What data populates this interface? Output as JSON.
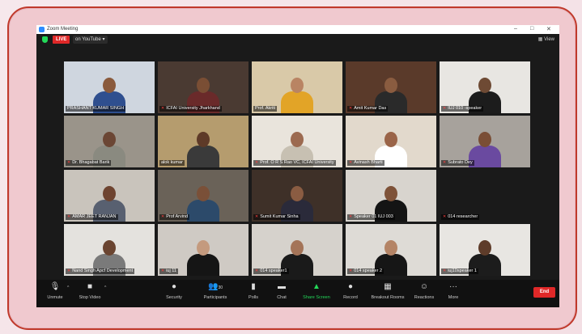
{
  "window": {
    "title": "Zoom Meeting",
    "minimize": "–",
    "maximize": "□",
    "close": "✕"
  },
  "topbar": {
    "live_label": "LIVE",
    "stream_label": "on YouTube ▾",
    "view_label": "▦ View"
  },
  "participants": [
    {
      "name": "PRASHANT KUMAR SINGH",
      "muted": false,
      "bg": "#cfd6df",
      "skin": "#8a5a3c",
      "shirt": "#2f4f8f",
      "active": false
    },
    {
      "name": "ICFAI University Jharkhand",
      "muted": true,
      "bg": "#4a3a32",
      "skin": "#7a4e34",
      "shirt": "#6a2a2a",
      "active": false
    },
    {
      "name": "Prof. Akriti",
      "muted": false,
      "bg": "#d9c9a8",
      "skin": "#b98463",
      "shirt": "#e2a427",
      "active": true
    },
    {
      "name": "Amit Kumar Das",
      "muted": true,
      "bg": "#5a3a2a",
      "skin": "#8a5c40",
      "shirt": "#2a2a2a",
      "active": false
    },
    {
      "name": "IUJ 010 -speaker",
      "muted": true,
      "bg": "#e8e6e2",
      "skin": "#6e4a34",
      "shirt": "#1c1c1c",
      "active": false
    },
    {
      "name": "Dr. Bhagabat Barik",
      "muted": true,
      "bg": "#9a948a",
      "skin": "#6b4634",
      "shirt": "#8a8a80",
      "active": false
    },
    {
      "name": "alok kumar",
      "muted": false,
      "bg": "#b59c6e",
      "skin": "#5e3a28",
      "shirt": "#3a3a3a",
      "active": false
    },
    {
      "name": "Prof. O R S Rao VC, ICFAI University",
      "muted": true,
      "bg": "#e9e4dc",
      "skin": "#9c6a50",
      "shirt": "#c7c0b2",
      "active": false
    },
    {
      "name": "Avinash Bharti",
      "muted": true,
      "bg": "#e2d9cc",
      "skin": "#9a6448",
      "shirt": "#ffffff",
      "active": false
    },
    {
      "name": "Subrato Dey",
      "muted": true,
      "bg": "#a7a29c",
      "skin": "#7a4e36",
      "shirt": "#6a4aa0",
      "active": false
    },
    {
      "name": "AMAR JEET RANJAN",
      "muted": true,
      "bg": "#c9c4bc",
      "skin": "#6e4430",
      "shirt": "#586070",
      "active": false
    },
    {
      "name": "Prof Arvind",
      "muted": true,
      "bg": "#6a6258",
      "skin": "#7a5038",
      "shirt": "#2c4a6a",
      "active": false
    },
    {
      "name": "Sumit Kumar Sinha",
      "muted": true,
      "bg": "#3e3028",
      "skin": "#8a5c42",
      "shirt": "#2a2a3a",
      "active": false
    },
    {
      "name": "Speaker 01 IUJ 003",
      "muted": true,
      "bg": "#d8d4ce",
      "skin": "#7e5238",
      "shirt": "#141414",
      "active": false
    },
    {
      "name": "014 researcher",
      "muted": true,
      "bg": "#1a1a1a",
      "skin": "#3a3a3a",
      "shirt": "#262626",
      "active": false
    },
    {
      "name": "Nand Singh Apcf Development",
      "muted": true,
      "bg": "#e4e2de",
      "skin": "#6a4430",
      "shirt": "#7a7a7a",
      "active": false
    },
    {
      "name": "iuj 11",
      "muted": true,
      "bg": "#cfcac4",
      "skin": "#c49a7e",
      "shirt": "#151515",
      "active": false
    },
    {
      "name": "014 speaker1",
      "muted": true,
      "bg": "#d6d2cc",
      "skin": "#a47458",
      "shirt": "#1a1a1a",
      "active": false
    },
    {
      "name": "014 speaker 2",
      "muted": true,
      "bg": "#dedbd6",
      "skin": "#b48466",
      "shirt": "#161616",
      "active": false
    },
    {
      "name": "iuj10speaker 1",
      "muted": true,
      "bg": "#e8e6e2",
      "skin": "#5e3c2a",
      "shirt": "#1c1c1c",
      "active": false
    }
  ],
  "toolbar": {
    "unmute": "Unmute",
    "stop_video": "Stop Video",
    "security": "Security",
    "participants": "Participants",
    "participants_count": "30",
    "polls": "Polls",
    "chat": "Chat",
    "share_screen": "Share Screen",
    "record": "Record",
    "breakout": "Breakout Rooms",
    "reactions": "Reactions",
    "more": "More",
    "end": "End"
  },
  "colors": {
    "accent_green": "#23d959",
    "end_red": "#e02828",
    "active_border": "#a5e34b",
    "frame_border": "#c0392b"
  }
}
